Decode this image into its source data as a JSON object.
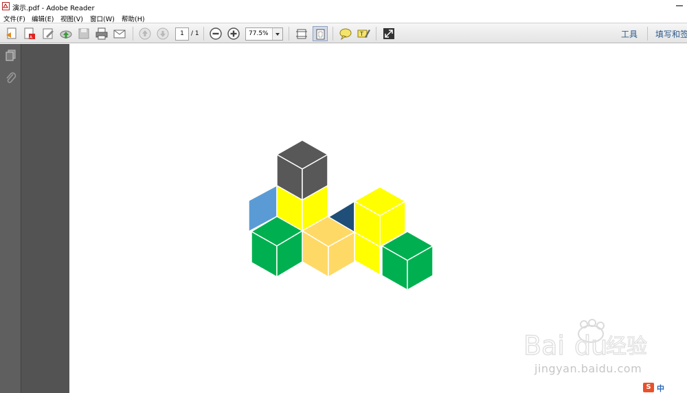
{
  "window": {
    "title": "演示.pdf - Adobe Reader"
  },
  "menu": {
    "items": [
      {
        "label": "文件(F)"
      },
      {
        "label": "编辑(E)"
      },
      {
        "label": "视图(V)"
      },
      {
        "label": "窗口(W)"
      },
      {
        "label": "帮助(H)"
      }
    ]
  },
  "toolbar": {
    "icons": [
      "open-icon",
      "create-pdf-icon",
      "edit-icon",
      "cloud-upload-icon",
      "save-icon",
      "print-icon",
      "email-icon",
      "page-up-icon",
      "page-down-icon",
      "zoom-out-icon",
      "zoom-in-icon",
      "fit-width-icon",
      "fit-page-icon",
      "comment-icon",
      "highlight-icon",
      "fullscreen-icon"
    ],
    "page_current": "1",
    "page_total": "/ 1",
    "zoom": "77.5%",
    "tools_label": "工具",
    "fill_sign_label": "填写和签"
  },
  "document": {
    "colors": {
      "dark_gray": "#585858",
      "yellow": "#ffff00",
      "light_blue": "#5b9bd5",
      "green": "#00b050",
      "peach": "#ffd966",
      "navy": "#1f4e79"
    }
  },
  "watermark": {
    "brand": "Bai du 经验",
    "url": "jingyan.baidu.com"
  },
  "ime": {
    "logo": "S",
    "mode": "中"
  }
}
